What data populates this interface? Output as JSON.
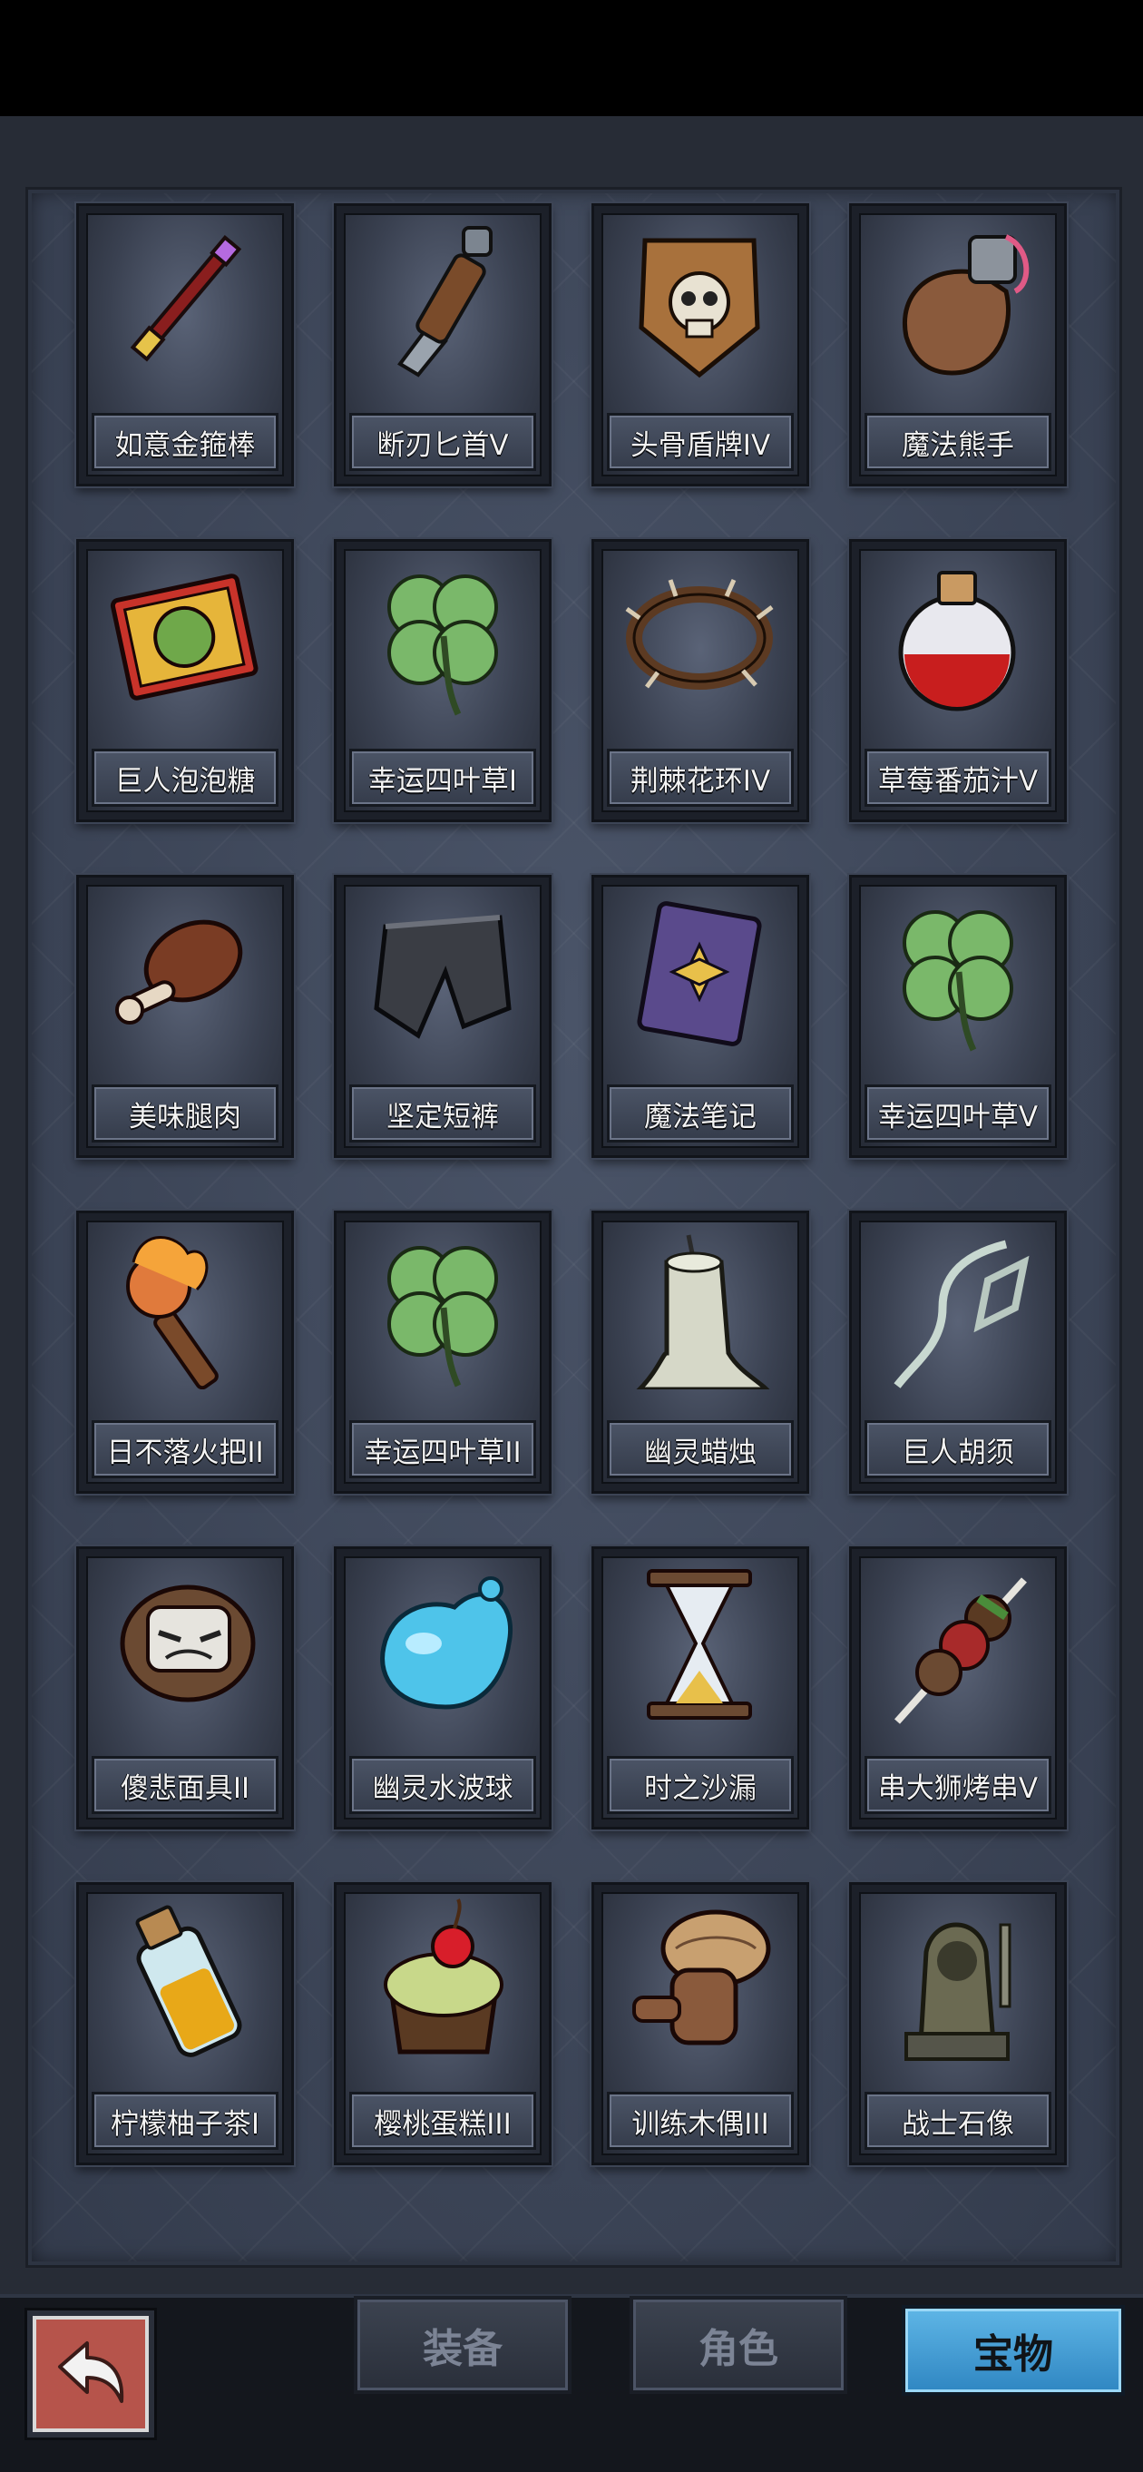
{
  "items": [
    {
      "name": "如意金箍棒",
      "icon": "golden-staff-icon"
    },
    {
      "name": "断刃匕首V",
      "icon": "broken-dagger-icon"
    },
    {
      "name": "头骨盾牌IV",
      "icon": "skull-shield-icon"
    },
    {
      "name": "魔法熊手",
      "icon": "bear-paw-icon"
    },
    {
      "name": "巨人泡泡糖",
      "icon": "bubble-gum-box-icon"
    },
    {
      "name": "幸运四叶草I",
      "icon": "four-leaf-clover-icon"
    },
    {
      "name": "荆棘花环IV",
      "icon": "thorn-wreath-icon"
    },
    {
      "name": "草莓番茄汁V",
      "icon": "red-potion-icon"
    },
    {
      "name": "美味腿肉",
      "icon": "meat-leg-icon"
    },
    {
      "name": "坚定短裤",
      "icon": "leather-shorts-icon"
    },
    {
      "name": "魔法笔记",
      "icon": "spell-book-icon"
    },
    {
      "name": "幸运四叶草V",
      "icon": "four-leaf-clover-icon"
    },
    {
      "name": "日不落火把II",
      "icon": "torch-icon"
    },
    {
      "name": "幸运四叶草II",
      "icon": "four-leaf-clover-icon"
    },
    {
      "name": "幽灵蜡烛",
      "icon": "ghost-candle-icon"
    },
    {
      "name": "巨人胡须",
      "icon": "giant-beard-icon"
    },
    {
      "name": "傻悲面具II",
      "icon": "sad-mask-icon"
    },
    {
      "name": "幽灵水波球",
      "icon": "water-orb-icon"
    },
    {
      "name": "时之沙漏",
      "icon": "hourglass-icon"
    },
    {
      "name": "串大狮烤串V",
      "icon": "kebab-skewer-icon"
    },
    {
      "name": "柠檬柚子茶I",
      "icon": "yellow-potion-icon"
    },
    {
      "name": "樱桃蛋糕III",
      "icon": "cherry-cake-icon"
    },
    {
      "name": "训练木偶III",
      "icon": "wooden-dummy-icon"
    },
    {
      "name": "战士石像",
      "icon": "warrior-statue-icon"
    }
  ],
  "nav": {
    "back_icon": "back-arrow-icon",
    "tabs": [
      {
        "label": "装备",
        "active": false
      },
      {
        "label": "角色",
        "active": false
      },
      {
        "label": "宝物",
        "active": true
      }
    ]
  },
  "colors": {
    "panel": "#3a4356",
    "active_tab": "#3d9ad6",
    "back_button": "#b6544b"
  }
}
